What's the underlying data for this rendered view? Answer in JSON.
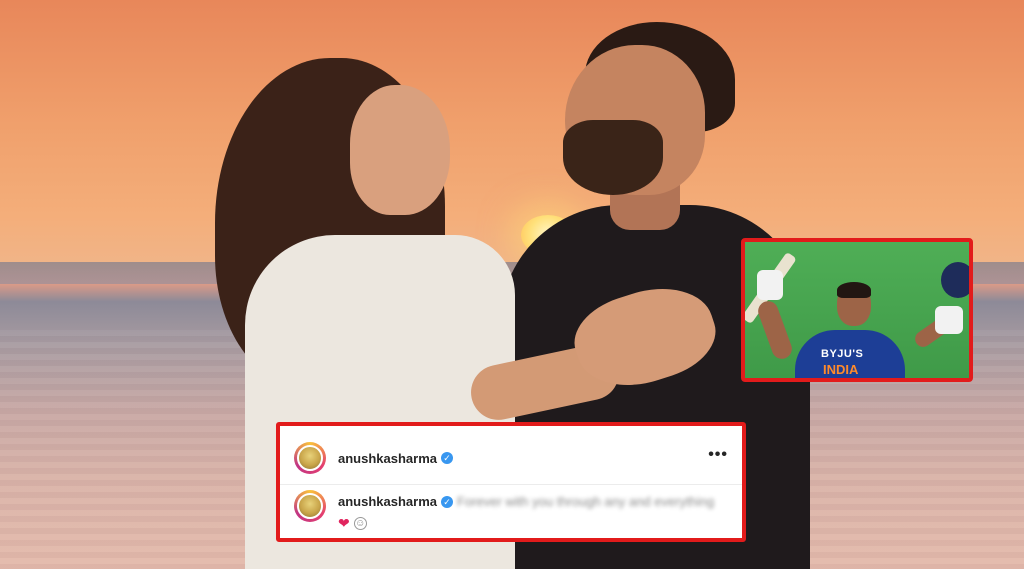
{
  "photo": {
    "subject_icon": "sunset-couple-photo"
  },
  "inset_photo": {
    "subject_icon": "cricketer-celebrating-photo",
    "jersey_sponsor": "BYJU'S",
    "jersey_team": "INDIA",
    "border_color": "#e21b1b"
  },
  "post": {
    "username": "anushkasharma",
    "more_icon": "•••",
    "verified_icon": "✓"
  },
  "comment": {
    "username": "anushkasharma",
    "text": "Forever with you through any and everything",
    "verified_icon": "✓",
    "heart_icon": "❤",
    "emoji_icon": "☺"
  },
  "colors": {
    "highlight_border": "#e21b1b",
    "verified": "#3897f0",
    "heart": "#e0245e"
  }
}
